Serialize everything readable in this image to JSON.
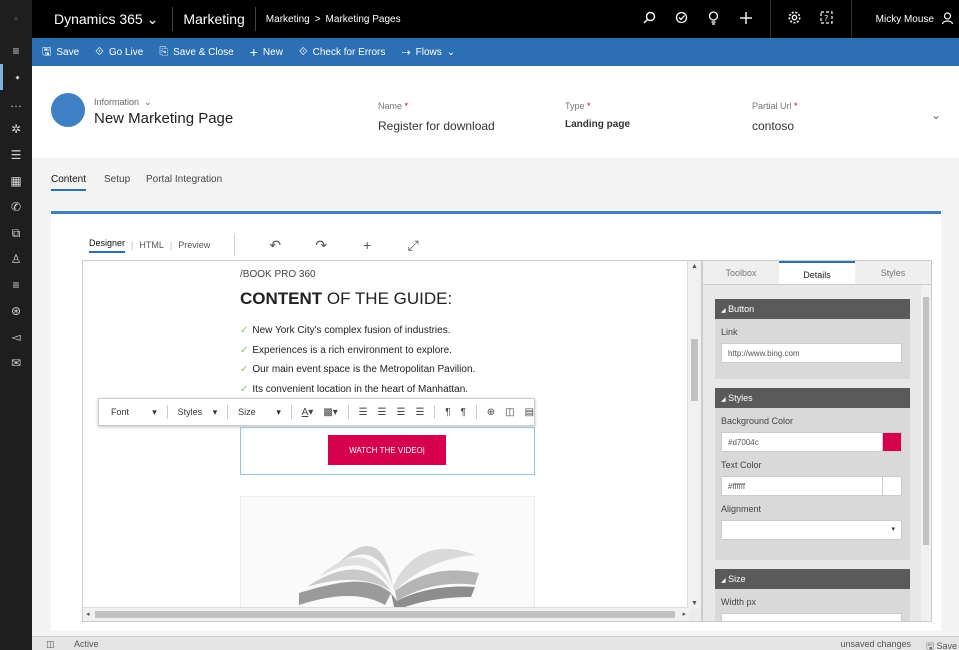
{
  "left_nav": {
    "items": [
      {
        "icon": "app-launcher-icon",
        "glyph": "▫"
      },
      {
        "icon": "menu-icon",
        "glyph": "≡"
      },
      {
        "icon": "pin-icon",
        "glyph": "⬩"
      },
      {
        "icon": "more-icon",
        "glyph": "…"
      },
      {
        "icon": "settings-gear-icon",
        "glyph": "✲"
      },
      {
        "icon": "list-icon",
        "glyph": "☰"
      },
      {
        "icon": "calendar-icon",
        "glyph": "▦"
      },
      {
        "icon": "phone-icon",
        "glyph": "✆"
      },
      {
        "icon": "segment-icon",
        "glyph": "⧉"
      },
      {
        "icon": "contact-icon",
        "glyph": "♙"
      },
      {
        "icon": "lines-icon",
        "glyph": "≡"
      },
      {
        "icon": "globe-icon",
        "glyph": "⊛"
      },
      {
        "icon": "megaphone-icon",
        "glyph": "◅"
      },
      {
        "icon": "mail-icon",
        "glyph": "✉"
      }
    ]
  },
  "topbar": {
    "brand": "Dynamics 365",
    "brand_chevron": "⌄",
    "app": "Marketing",
    "breadcrumb": [
      "Marketing",
      "Marketing Pages"
    ],
    "breadcrumb_sep": ">",
    "user": "Micky Mouse"
  },
  "commands": [
    {
      "icon": "save-icon",
      "glyph": "🖫",
      "label": "Save"
    },
    {
      "icon": "go-live-icon",
      "glyph": "⟐",
      "label": "Go Live"
    },
    {
      "icon": "save-close-icon",
      "glyph": "⎘",
      "label": "Save & Close"
    },
    {
      "icon": "new-icon",
      "glyph": "+",
      "label": "New"
    },
    {
      "icon": "check-errors-icon",
      "glyph": "⟐",
      "label": "Check for Errors"
    },
    {
      "icon": "flows-icon",
      "glyph": "⇢",
      "label": "Flows"
    }
  ],
  "header": {
    "form_type": "Information",
    "title": "New Marketing Page",
    "fields": [
      {
        "label": "Name",
        "value": "Register for download"
      },
      {
        "label": "Type",
        "value": "Landing page"
      },
      {
        "label": "Partial Url",
        "value": "contoso"
      }
    ],
    "required_mark": "*"
  },
  "tabs": [
    "Content",
    "Setup",
    "Portal Integration"
  ],
  "designer": {
    "views": [
      "Designer",
      "HTML",
      "Preview"
    ],
    "view_sep": "|"
  },
  "canvas": {
    "eyebrow": "/BOOK PRO 360",
    "heading_bold": "CONTENT",
    "heading_rest": " OF THE GUIDE:",
    "check": "✓",
    "bullets": [
      "New York City's complex fusion of industries.",
      "Experiences is a rich environment to explore.",
      "Our main event space is the Metropolitan Pavilion.",
      "Its convenient location in the heart of Manhattan."
    ],
    "rte": {
      "font": "Font",
      "styles": "Styles",
      "size": "Size"
    },
    "button_label": "WATCH THE VIDEO|"
  },
  "panel": {
    "tabs": [
      "Toolbox",
      "Details",
      "Styles"
    ],
    "button_section": {
      "title": "Button",
      "link_label": "Link",
      "link_value": "http://www.bing.com"
    },
    "styles_section": {
      "title": "Styles",
      "bg_label": "Background Color",
      "bg_value": "#d7004c",
      "text_label": "Text Color",
      "text_value": "#ffffff",
      "align_label": "Alignment"
    },
    "size_section": {
      "title": "Size",
      "width_label": "Width px"
    },
    "collapse_glyph": "◢"
  },
  "status": {
    "state": "Active",
    "unsaved": "unsaved changes",
    "save": "Save"
  },
  "colors": {
    "accent": "#2c6fb2",
    "button": "#d7004c",
    "white": "#ffffff"
  }
}
